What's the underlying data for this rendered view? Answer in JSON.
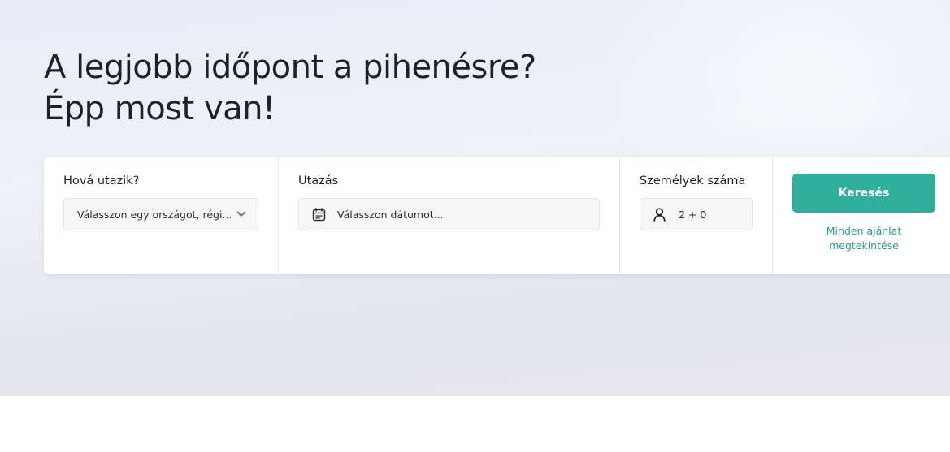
{
  "hero": {
    "headline_line1": "A legjobb időpont a pihenésre?",
    "headline_line2": "Épp most van!"
  },
  "search": {
    "destination": {
      "label": "Hová utazik?",
      "value": "Válasszon egy országot, régi...",
      "icon": "chevron-down-icon"
    },
    "dates": {
      "label": "Utazás",
      "value": "Válasszon dátumot...",
      "icon": "calendar-icon"
    },
    "people": {
      "label": "Személyek száma",
      "value": "2 + 0",
      "icon": "person-icon"
    },
    "submit_label": "Keresés",
    "all_offers_label": "Minden ajánlat megtekintése"
  },
  "colors": {
    "accent": "#2faf9b",
    "link": "#2a9e8c",
    "text": "#1f2126"
  }
}
